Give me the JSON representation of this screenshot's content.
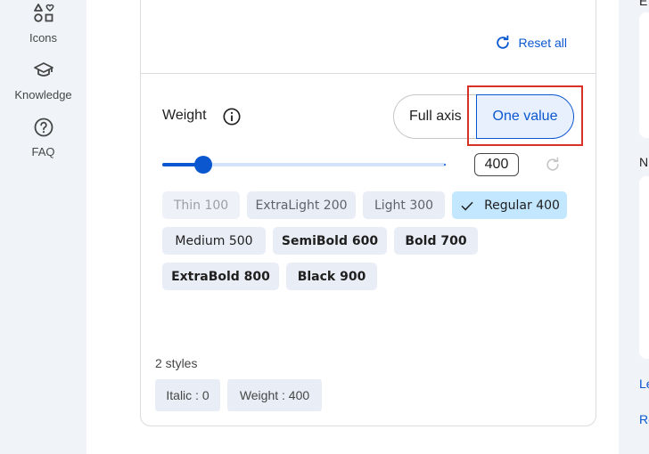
{
  "nav": {
    "items": [
      {
        "label": "Icons",
        "icon": "shapes-icon"
      },
      {
        "label": "Knowledge",
        "icon": "school-icon"
      },
      {
        "label": "FAQ",
        "icon": "help-icon"
      }
    ]
  },
  "card": {
    "reset_all_label": "Reset all",
    "weight": {
      "label": "Weight",
      "toggle": {
        "full_axis_label": "Full axis",
        "one_value_label": "One value",
        "selected": "one_value"
      },
      "slider": {
        "min": 100,
        "max": 900,
        "value": 400
      },
      "value_display": "400",
      "chips": [
        {
          "label": "Thin 100",
          "weight": 100,
          "selected": false
        },
        {
          "label": "ExtraLight 200",
          "weight": 200,
          "selected": false
        },
        {
          "label": "Light 300",
          "weight": 300,
          "selected": false
        },
        {
          "label": "Regular 400",
          "weight": 400,
          "selected": true
        },
        {
          "label": "Medium 500",
          "weight": 500,
          "selected": false
        },
        {
          "label": "SemiBold 600",
          "weight": 600,
          "selected": false
        },
        {
          "label": "Bold 700",
          "weight": 700,
          "selected": false
        },
        {
          "label": "ExtraBold 800",
          "weight": 800,
          "selected": false
        },
        {
          "label": "Black 900",
          "weight": 900,
          "selected": false
        }
      ]
    },
    "styles": {
      "count_label": "2 styles",
      "tags": [
        {
          "label": "Italic : 0"
        },
        {
          "label": "Weight : 400"
        }
      ]
    }
  },
  "right_panel": {
    "partial_labels": [
      "E",
      "N",
      "Le",
      "Re"
    ]
  },
  "colors": {
    "accent": "#0b57d0",
    "highlight": "#d93025",
    "chip_bg": "#e9eef6",
    "chip_selected_bg": "#c2e7ff",
    "rail_bg": "#f0f4f9"
  }
}
